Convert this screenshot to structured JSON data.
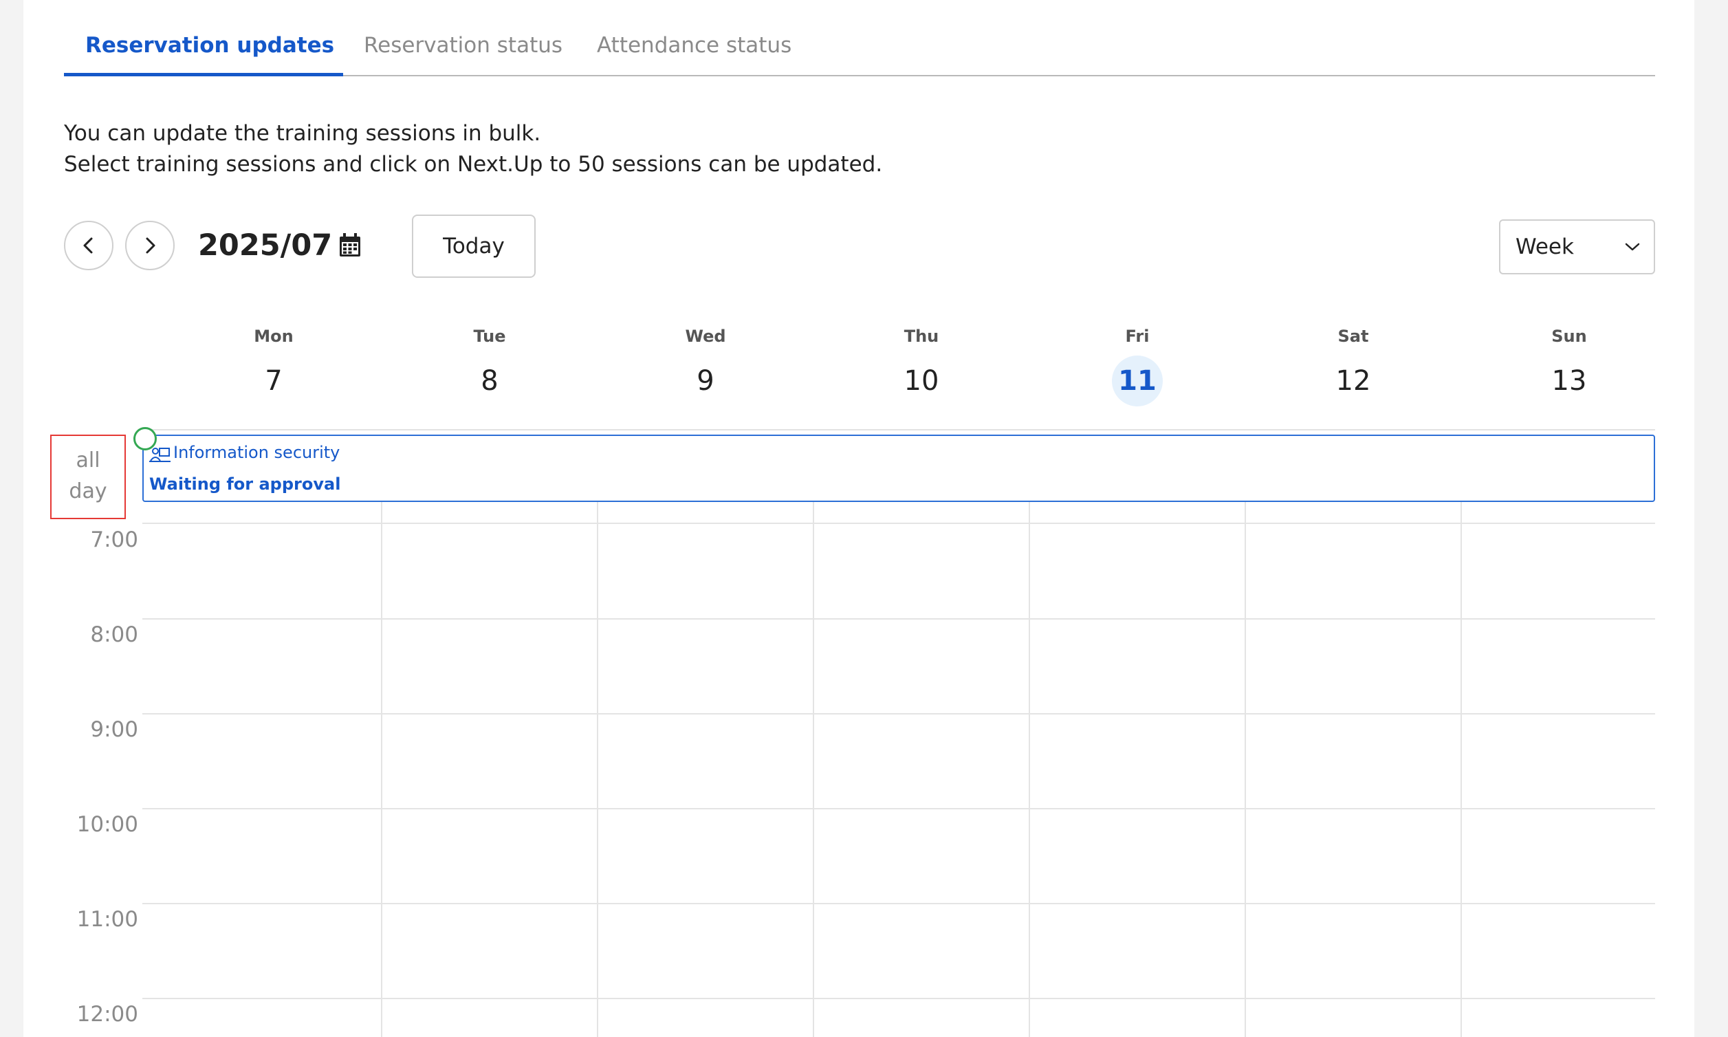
{
  "tabs": [
    {
      "label": "Reservation updates",
      "active": true
    },
    {
      "label": "Reservation status",
      "active": false
    },
    {
      "label": "Attendance status",
      "active": false
    }
  ],
  "intro": {
    "line1": "You can update the training sessions in bulk.",
    "line2": "Select training sessions and click on Next.Up to 50 sessions can be updated."
  },
  "toolbar": {
    "prev_icon": "chevron-left-icon",
    "next_icon": "chevron-right-icon",
    "month": "2025/07",
    "calendar_icon": "calendar-icon",
    "today_label": "Today",
    "view_selected": "Week"
  },
  "days": [
    {
      "name": "Mon",
      "num": "7"
    },
    {
      "name": "Tue",
      "num": "8"
    },
    {
      "name": "Wed",
      "num": "9"
    },
    {
      "name": "Thu",
      "num": "10"
    },
    {
      "name": "Fri",
      "num": "11",
      "today": true
    },
    {
      "name": "Sat",
      "num": "12"
    },
    {
      "name": "Sun",
      "num": "13"
    }
  ],
  "all_day": {
    "line1": "all",
    "line2": "day"
  },
  "event": {
    "icon": "training-icon",
    "title": "Information security",
    "status": "Waiting for approval"
  },
  "times": [
    "7:00",
    "8:00",
    "9:00",
    "10:00",
    "11:00",
    "12:00"
  ],
  "colors": {
    "accent": "#1558c9",
    "today_bg": "#e5f1fc",
    "event_border": "#2d6fd6",
    "highlight": "#e53935",
    "dot": "#34a853"
  }
}
